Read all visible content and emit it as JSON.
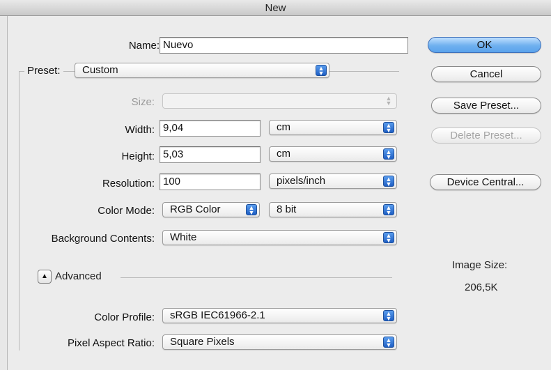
{
  "window": {
    "title": "New"
  },
  "form": {
    "name_label": "Name:",
    "name_value": "Nuevo",
    "preset_label": "Preset:",
    "preset_value": "Custom",
    "size_label": "Size:",
    "size_value": "",
    "width_label": "Width:",
    "width_value": "9,04",
    "width_unit": "cm",
    "height_label": "Height:",
    "height_value": "5,03",
    "height_unit": "cm",
    "resolution_label": "Resolution:",
    "resolution_value": "100",
    "resolution_unit": "pixels/inch",
    "color_mode_label": "Color Mode:",
    "color_mode_value": "RGB Color",
    "bit_depth_value": "8 bit",
    "background_label": "Background Contents:",
    "background_value": "White",
    "advanced_label": "Advanced",
    "color_profile_label": "Color Profile:",
    "color_profile_value": "sRGB IEC61966-2.1",
    "pixel_aspect_label": "Pixel Aspect Ratio:",
    "pixel_aspect_value": "Square Pixels"
  },
  "buttons": {
    "ok": "OK",
    "cancel": "Cancel",
    "save_preset": "Save Preset...",
    "delete_preset": "Delete Preset...",
    "device_central": "Device Central..."
  },
  "image_size": {
    "label": "Image Size:",
    "value": "206,5K"
  },
  "colors": {
    "default_button": "#6fb0ef",
    "popup_arrows": "#3a7fdc",
    "dialog_background": "#ececec"
  }
}
